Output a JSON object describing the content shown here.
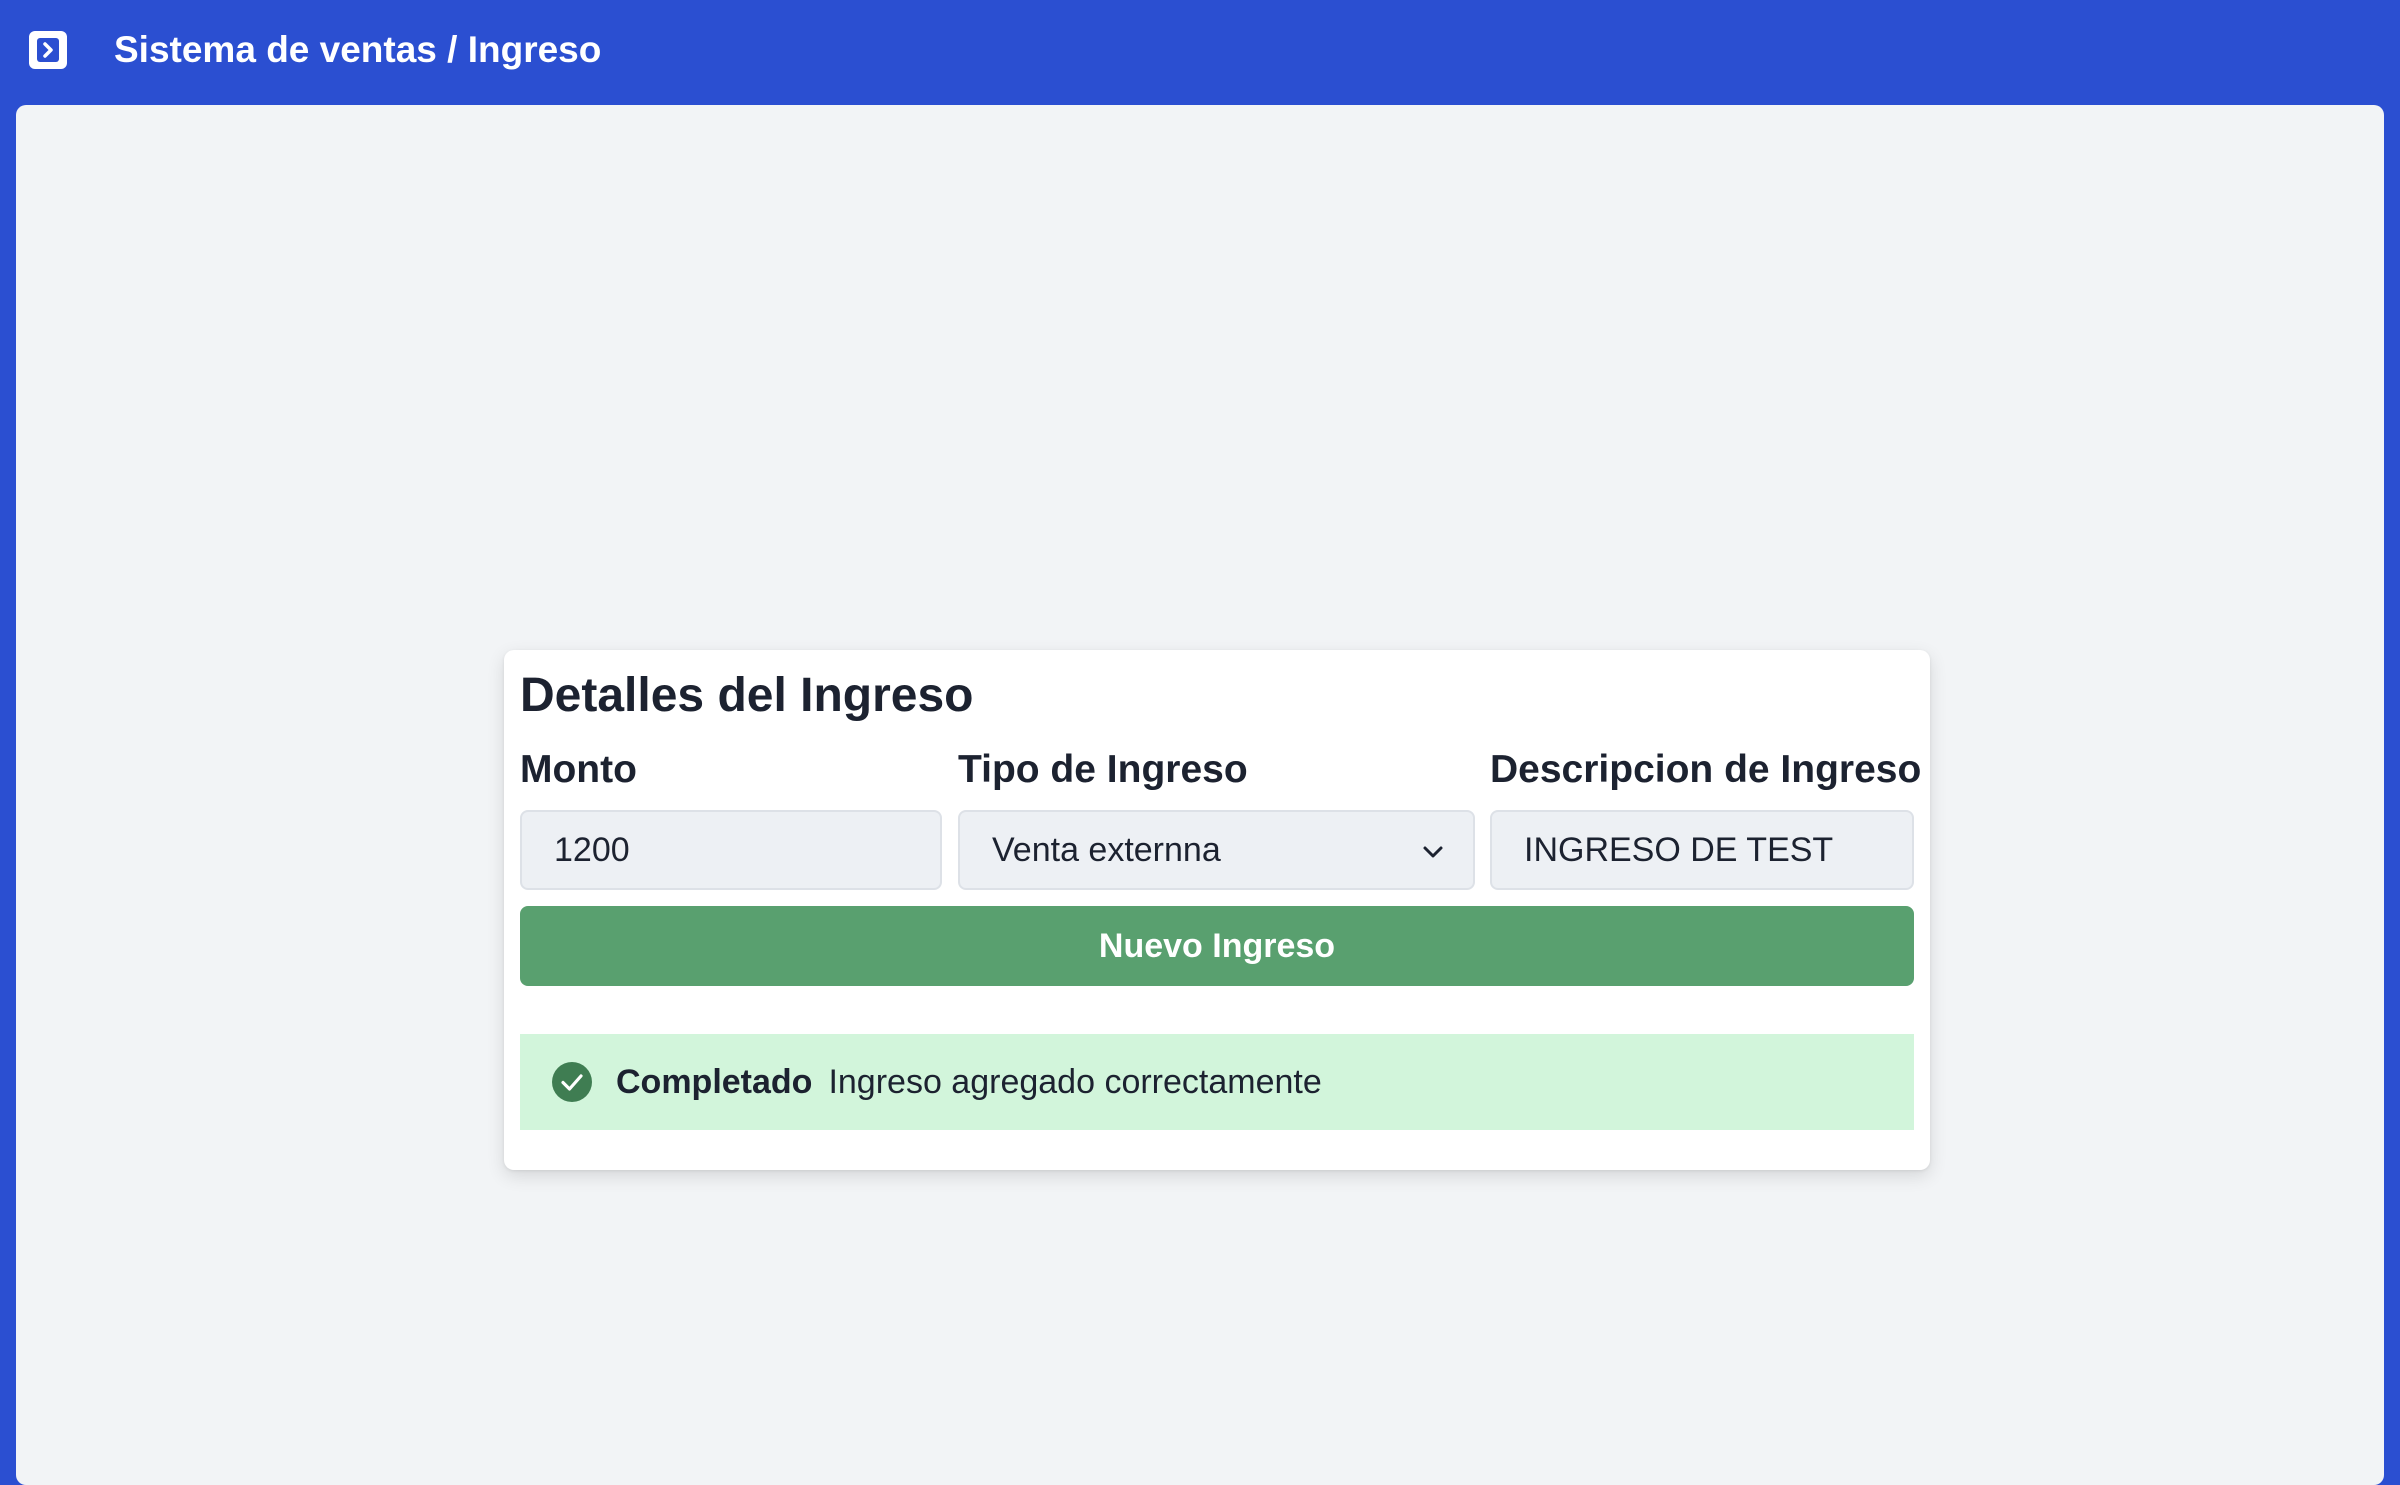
{
  "header": {
    "title": "Sistema de ventas / Ingreso",
    "toggle_icon": "sidebar-toggle-icon",
    "background": "#2b4fd1"
  },
  "form": {
    "title": "Detalles del Ingreso",
    "fields": {
      "amount": {
        "label": "Monto",
        "value": "1200"
      },
      "type": {
        "label": "Tipo de Ingreso",
        "selected": "Venta externna"
      },
      "description": {
        "label": "Descripcion de Ingreso",
        "value": "INGRESO DE TEST"
      }
    },
    "submit_label": "Nuevo Ingreso",
    "submit_color": "#59a06f"
  },
  "alert": {
    "icon": "check-circle-icon",
    "title": "Completado",
    "message": "Ingreso agregado correctamente",
    "background": "#d2f5db",
    "icon_color": "#3f7d52"
  }
}
